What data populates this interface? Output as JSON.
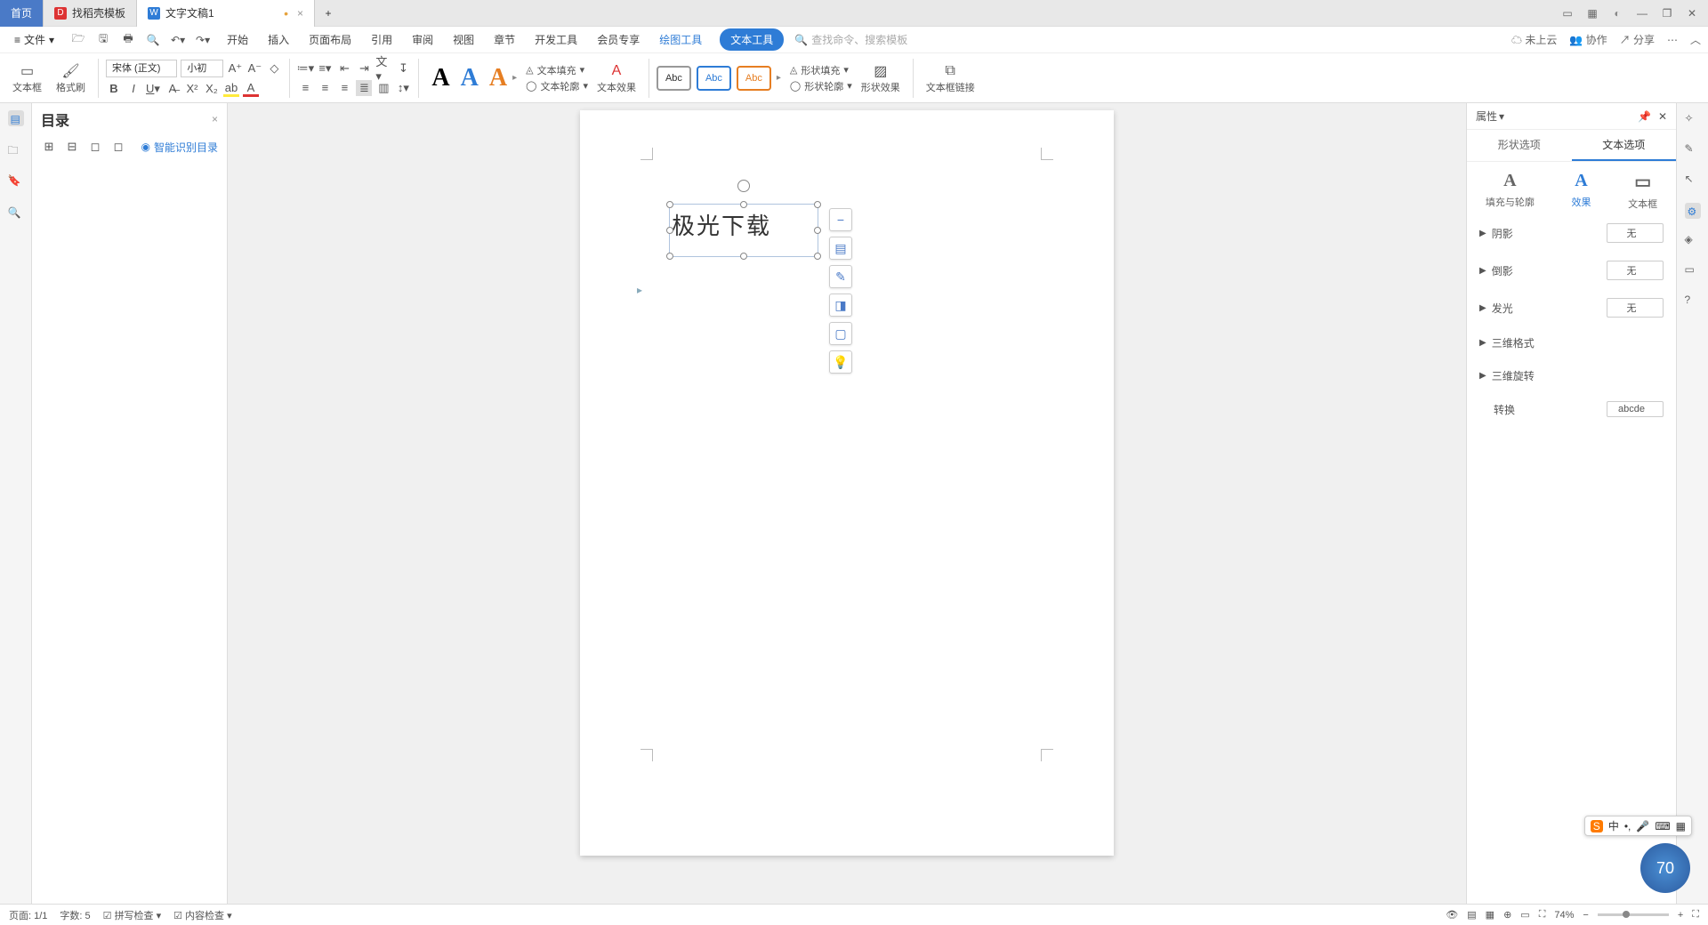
{
  "tabs": {
    "home": "首页",
    "template": "找稻壳模板",
    "doc": "文字文稿1"
  },
  "menu": {
    "file": "文件",
    "items": [
      "开始",
      "插入",
      "页面布局",
      "引用",
      "审阅",
      "视图",
      "章节",
      "开发工具",
      "会员专享"
    ],
    "draw_tool": "绘图工具",
    "text_tool": "文本工具",
    "search_ph": "查找命令、搜索模板"
  },
  "right_menu": {
    "cloud": "未上云",
    "coop": "协作",
    "share": "分享"
  },
  "ribbon": {
    "textbox": "文本框",
    "brush": "格式刷",
    "font": "宋体 (正文)",
    "size": "小初",
    "text_fill": "文本填充",
    "text_outline": "文本轮廓",
    "text_effect": "文本效果",
    "abc": "Abc",
    "shape_fill": "形状填充",
    "shape_outline": "形状轮廓",
    "shape_effect": "形状效果",
    "text_link": "文本框链接"
  },
  "toc": {
    "title": "目录",
    "auto": "智能识别目录"
  },
  "textbox_content": "极光下载",
  "panel": {
    "title": "属性",
    "tab_shape": "形状选项",
    "tab_text": "文本选项",
    "sub_fill": "填充与轮廓",
    "sub_effect": "效果",
    "sub_textbox": "文本框",
    "rows": {
      "shadow": "阴影",
      "reflect": "倒影",
      "glow": "发光",
      "fmt3d": "三维格式",
      "rot3d": "三维旋转",
      "transform": "转换"
    },
    "none": "无",
    "abcde": "abcde"
  },
  "status": {
    "page": "页面: 1/1",
    "words": "字数: 5",
    "spell": "拼写检查",
    "content": "内容检查",
    "zoom": "74%"
  },
  "net": "70",
  "ime": "中"
}
